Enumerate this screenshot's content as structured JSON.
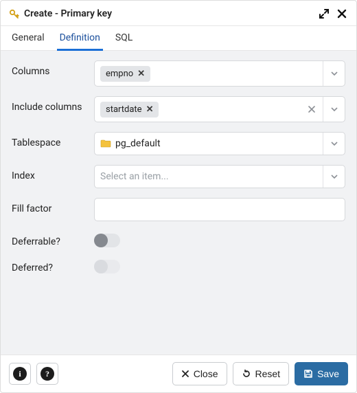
{
  "dialog": {
    "title": "Create - Primary key"
  },
  "tabs": [
    {
      "label": "General",
      "active": false
    },
    {
      "label": "Definition",
      "active": true
    },
    {
      "label": "SQL",
      "active": false
    }
  ],
  "form": {
    "columns": {
      "label": "Columns",
      "chips": [
        "empno"
      ]
    },
    "include_columns": {
      "label": "Include columns",
      "chips": [
        "startdate"
      ]
    },
    "tablespace": {
      "label": "Tablespace",
      "value": "pg_default"
    },
    "index": {
      "label": "Index",
      "placeholder": "Select an item..."
    },
    "fill_factor": {
      "label": "Fill factor",
      "value": ""
    },
    "deferrable": {
      "label": "Deferrable?",
      "value": false,
      "enabled": true
    },
    "deferred": {
      "label": "Deferred?",
      "value": false,
      "enabled": false
    }
  },
  "footer": {
    "close": "Close",
    "reset": "Reset",
    "save": "Save"
  }
}
